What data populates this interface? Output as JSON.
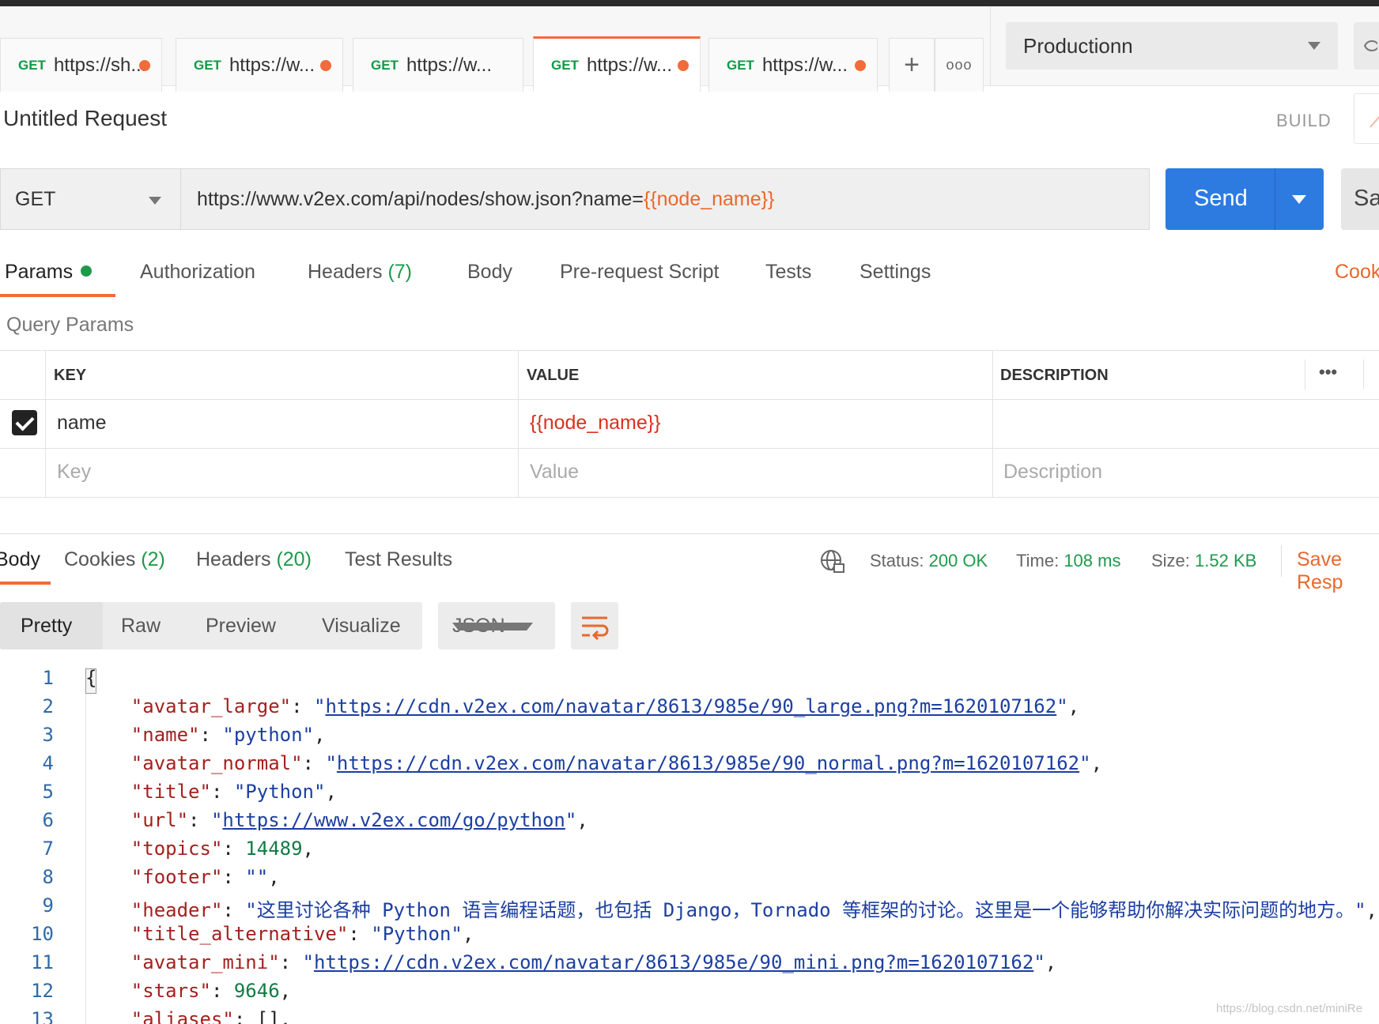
{
  "request_tabs": [
    {
      "method": "GET",
      "label": "https://sh...",
      "unsaved": true
    },
    {
      "method": "GET",
      "label": "https://w...",
      "unsaved": true
    },
    {
      "method": "GET",
      "label": "https://w...",
      "unsaved": false
    },
    {
      "method": "GET",
      "label": "https://w...",
      "unsaved": true,
      "active": true
    },
    {
      "method": "GET",
      "label": "https://w...",
      "unsaved": true
    }
  ],
  "tab_actions": {
    "new_tab": "+",
    "more": "ooo"
  },
  "environment": {
    "selected": "Productionn"
  },
  "request": {
    "title": "Untitled Request",
    "mode": "BUILD",
    "method": "GET",
    "url_base": "https://www.v2ex.com/api/nodes/show.json?name=",
    "url_var": "{{node_name}}",
    "send_label": "Send",
    "save_label": "Sav"
  },
  "request_tabs_nav": {
    "params": "Params",
    "authorization": "Authorization",
    "headers": "Headers",
    "headers_count": "(7)",
    "body": "Body",
    "prerequest": "Pre-request Script",
    "tests": "Tests",
    "settings": "Settings",
    "cookies": "Cook"
  },
  "query_params": {
    "label": "Query Params",
    "columns": {
      "key": "KEY",
      "value": "VALUE",
      "description": "DESCRIPTION"
    },
    "more": "•••",
    "rows": [
      {
        "key": "name",
        "value": "{{node_name}}",
        "description": "",
        "checked": true
      }
    ],
    "placeholders": {
      "key": "Key",
      "value": "Value",
      "description": "Description"
    }
  },
  "response_tabs": {
    "body": "Body",
    "cookies": "Cookies",
    "cookies_count": "(2)",
    "headers": "Headers",
    "headers_count": "(20)",
    "test_results": "Test Results"
  },
  "response_status": {
    "status_label": "Status:",
    "status_value": "200 OK",
    "time_label": "Time:",
    "time_value": "108 ms",
    "size_label": "Size:",
    "size_value": "1.52 KB",
    "save_response": "Save Resp"
  },
  "view_options": {
    "pretty": "Pretty",
    "raw": "Raw",
    "preview": "Preview",
    "visualize": "Visualize",
    "format": "JSON"
  },
  "code_lines": [
    {
      "n": "1",
      "parts": [
        {
          "t": "{",
          "c": "p"
        }
      ]
    },
    {
      "n": "2",
      "parts": [
        {
          "t": "    \"avatar_large\"",
          "c": "k"
        },
        {
          "t": ": ",
          "c": "p"
        },
        {
          "t": "\"",
          "c": "s"
        },
        {
          "t": "https://cdn.v2ex.com/navatar/8613/985e/90_large.png?m=1620107162",
          "c": "u"
        },
        {
          "t": "\"",
          "c": "s"
        },
        {
          "t": ",",
          "c": "p"
        }
      ]
    },
    {
      "n": "3",
      "parts": [
        {
          "t": "    \"name\"",
          "c": "k"
        },
        {
          "t": ": ",
          "c": "p"
        },
        {
          "t": "\"python\"",
          "c": "s"
        },
        {
          "t": ",",
          "c": "p"
        }
      ]
    },
    {
      "n": "4",
      "parts": [
        {
          "t": "    \"avatar_normal\"",
          "c": "k"
        },
        {
          "t": ": ",
          "c": "p"
        },
        {
          "t": "\"",
          "c": "s"
        },
        {
          "t": "https://cdn.v2ex.com/navatar/8613/985e/90_normal.png?m=1620107162",
          "c": "u"
        },
        {
          "t": "\"",
          "c": "s"
        },
        {
          "t": ",",
          "c": "p"
        }
      ]
    },
    {
      "n": "5",
      "parts": [
        {
          "t": "    \"title\"",
          "c": "k"
        },
        {
          "t": ": ",
          "c": "p"
        },
        {
          "t": "\"Python\"",
          "c": "s"
        },
        {
          "t": ",",
          "c": "p"
        }
      ]
    },
    {
      "n": "6",
      "parts": [
        {
          "t": "    \"url\"",
          "c": "k"
        },
        {
          "t": ": ",
          "c": "p"
        },
        {
          "t": "\"",
          "c": "s"
        },
        {
          "t": "https://www.v2ex.com/go/python",
          "c": "u"
        },
        {
          "t": "\"",
          "c": "s"
        },
        {
          "t": ",",
          "c": "p"
        }
      ]
    },
    {
      "n": "7",
      "parts": [
        {
          "t": "    \"topics\"",
          "c": "k"
        },
        {
          "t": ": ",
          "c": "p"
        },
        {
          "t": "14489",
          "c": "n"
        },
        {
          "t": ",",
          "c": "p"
        }
      ]
    },
    {
      "n": "8",
      "parts": [
        {
          "t": "    \"footer\"",
          "c": "k"
        },
        {
          "t": ": ",
          "c": "p"
        },
        {
          "t": "\"\"",
          "c": "s"
        },
        {
          "t": ",",
          "c": "p"
        }
      ]
    },
    {
      "n": "9",
      "parts": [
        {
          "t": "    \"header\"",
          "c": "k"
        },
        {
          "t": ": ",
          "c": "p"
        },
        {
          "t": "\"这里讨论各种 Python 语言编程话题，也包括 Django，Tornado 等框架的讨论。这里是一个能够帮助你解决实际问题的地方。\"",
          "c": "s"
        },
        {
          "t": ",",
          "c": "p"
        }
      ]
    },
    {
      "n": "10",
      "parts": [
        {
          "t": "    \"title_alternative\"",
          "c": "k"
        },
        {
          "t": ": ",
          "c": "p"
        },
        {
          "t": "\"Python\"",
          "c": "s"
        },
        {
          "t": ",",
          "c": "p"
        }
      ]
    },
    {
      "n": "11",
      "parts": [
        {
          "t": "    \"avatar_mini\"",
          "c": "k"
        },
        {
          "t": ": ",
          "c": "p"
        },
        {
          "t": "\"",
          "c": "s"
        },
        {
          "t": "https://cdn.v2ex.com/navatar/8613/985e/90_mini.png?m=1620107162",
          "c": "u"
        },
        {
          "t": "\"",
          "c": "s"
        },
        {
          "t": ",",
          "c": "p"
        }
      ]
    },
    {
      "n": "12",
      "parts": [
        {
          "t": "    \"stars\"",
          "c": "k"
        },
        {
          "t": ": ",
          "c": "p"
        },
        {
          "t": "9646",
          "c": "n"
        },
        {
          "t": ",",
          "c": "p"
        }
      ]
    },
    {
      "n": "13",
      "parts": [
        {
          "t": "    \"aliases\"",
          "c": "k"
        },
        {
          "t": ": ",
          "c": "p"
        },
        {
          "t": "[]",
          "c": "p"
        },
        {
          "t": ",",
          "c": "p"
        }
      ]
    }
  ],
  "watermark": "https://blog.csdn.net/miniRe",
  "colors": {
    "accent": "#f26b3a",
    "send": "#2d7be0",
    "success": "#1e9a4b"
  }
}
